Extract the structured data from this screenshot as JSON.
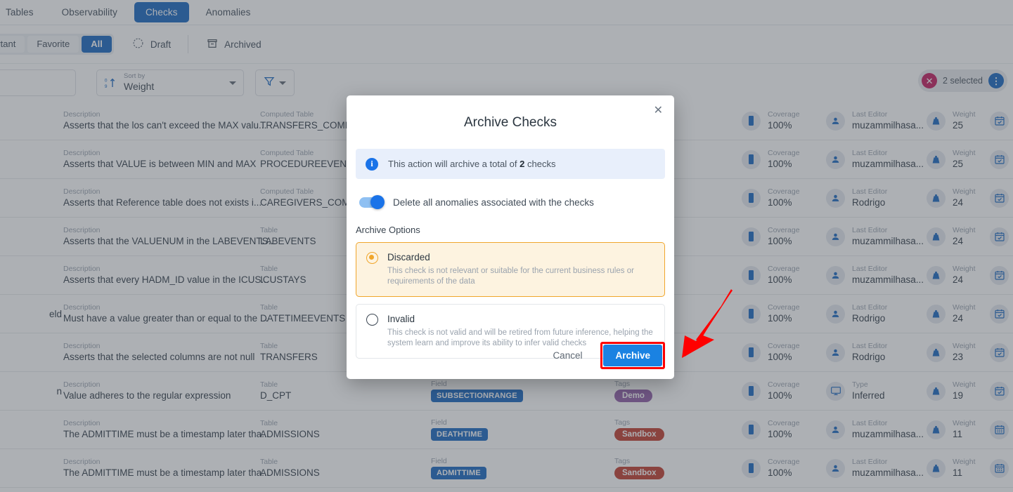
{
  "topnav": {
    "tabs": [
      {
        "label": "Tables",
        "active": false
      },
      {
        "label": "Observability",
        "active": false
      },
      {
        "label": "Checks",
        "active": true
      },
      {
        "label": "Anomalies",
        "active": false
      }
    ]
  },
  "filterbar": {
    "segments": [
      {
        "label": "mportant",
        "active": false
      },
      {
        "label": "Favorite",
        "active": false
      },
      {
        "label": "All",
        "active": true
      }
    ],
    "draft_label": "Draft",
    "archived_label": "Archived",
    "draft_icon": "draft-check-circle-icon",
    "archived_icon": "archive-box-icon"
  },
  "controls": {
    "search_placeholder": "",
    "sort_caption": "Sort by",
    "sort_value": "Weight",
    "sort_icon": "sort-ascending-icon",
    "filter_icon": "funnel-icon",
    "selection": {
      "count_label": "2 selected",
      "clear_icon": "close-circle-icon",
      "menu_icon": "more-vertical-icon",
      "clear_color": "#c2185b",
      "menu_color": "#1565c0"
    }
  },
  "table": {
    "labels": {
      "description": "Description",
      "computed_table": "Computed Table",
      "table": "Table",
      "field": "Field",
      "tags": "Tags",
      "coverage": "Coverage",
      "last_editor": "Last Editor",
      "type": "Type",
      "weight": "Weight"
    },
    "rows": [
      {
        "left_fragment": "",
        "description": "Asserts that the los can't exceed the MAX valu...",
        "table_label": "Computed Table",
        "table_value": "TRANSFERS_COMPUTE",
        "field": "",
        "tag": null,
        "coverage": "100%",
        "editor_label": "Last Editor",
        "editor": "muzammilhasa...",
        "editor_icon": "person-icon",
        "weight": "25",
        "calendar_icon": "calendar-check-icon"
      },
      {
        "left_fragment": "",
        "description": "Asserts that VALUE is between MIN and MAX",
        "table_label": "Computed Table",
        "table_value": "PROCEDUREEVENTS_M",
        "field": "",
        "tag": null,
        "coverage": "100%",
        "editor_label": "Last Editor",
        "editor": "muzammilhasa...",
        "editor_icon": "person-icon",
        "weight": "25",
        "calendar_icon": "calendar-check-icon"
      },
      {
        "left_fragment": "",
        "description": "Asserts that Reference table does not exists i...",
        "table_label": "Computed Table",
        "table_value": "CAREGIVERS_COMPUT",
        "field": "",
        "tag": null,
        "coverage": "100%",
        "editor_label": "Last Editor",
        "editor": "Rodrigo",
        "editor_icon": "person-icon",
        "weight": "24",
        "calendar_icon": "calendar-check-icon"
      },
      {
        "left_fragment": "",
        "description": "Asserts that the VALUENUM in the LABEVENTS...",
        "table_label": "Table",
        "table_value": "LABEVENTS",
        "field": "",
        "tag": null,
        "coverage": "100%",
        "editor_label": "Last Editor",
        "editor": "muzammilhasa...",
        "editor_icon": "person-icon",
        "weight": "24",
        "calendar_icon": "calendar-check-icon"
      },
      {
        "left_fragment": "",
        "description": "Asserts that every HADM_ID value in the ICUS...",
        "table_label": "Table",
        "table_value": "ICUSTAYS",
        "field": "",
        "tag": null,
        "coverage": "100%",
        "editor_label": "Last Editor",
        "editor": "muzammilhasa...",
        "editor_icon": "person-icon",
        "weight": "24",
        "calendar_icon": "calendar-check-icon"
      },
      {
        "left_fragment": "eld",
        "description": "Must have a value greater than or equal to the ...",
        "table_label": "Table",
        "table_value": "DATETIMEEVENTS",
        "field": "",
        "tag": null,
        "coverage": "100%",
        "editor_label": "Last Editor",
        "editor": "Rodrigo",
        "editor_icon": "person-icon",
        "weight": "24",
        "calendar_icon": "calendar-check-icon"
      },
      {
        "left_fragment": "",
        "description": "Asserts that the selected columns are not null",
        "table_label": "Table",
        "table_value": "TRANSFERS",
        "field": "",
        "tag": null,
        "coverage": "100%",
        "editor_label": "Last Editor",
        "editor": "Rodrigo",
        "editor_icon": "person-icon",
        "weight": "23",
        "calendar_icon": "calendar-check-icon"
      },
      {
        "left_fragment": "n",
        "description": "Value adheres to the regular expression",
        "table_label": "Table",
        "table_value": "D_CPT",
        "field": "SUBSECTIONRANGE",
        "tag": {
          "text": "Demo",
          "color": "#8e5ba6"
        },
        "coverage": "100%",
        "editor_label": "Type",
        "editor": "Inferred",
        "editor_icon": "monitor-icon",
        "weight": "19",
        "calendar_icon": "calendar-check-icon"
      },
      {
        "left_fragment": "",
        "description": "The ADMITTIME must be a timestamp later tha...",
        "table_label": "Table",
        "table_value": "ADMISSIONS",
        "field": "DEATHTIME",
        "tag": {
          "text": "Sandbox",
          "color": "#c0392b"
        },
        "coverage": "100%",
        "editor_label": "Last Editor",
        "editor": "muzammilhasa...",
        "editor_icon": "person-icon",
        "weight": "11",
        "calendar_icon": "calendar-grid-icon"
      },
      {
        "left_fragment": "",
        "description": "The ADMITTIME must be a timestamp later tha...",
        "table_label": "Table",
        "table_value": "ADMISSIONS",
        "field": "ADMITTIME",
        "tag": {
          "text": "Sandbox",
          "color": "#c0392b"
        },
        "coverage": "100%",
        "editor_label": "Last Editor",
        "editor": "muzammilhasa...",
        "editor_icon": "person-icon",
        "weight": "11",
        "calendar_icon": "calendar-grid-icon"
      }
    ]
  },
  "modal": {
    "title": "Archive Checks",
    "close_icon": "close-icon",
    "info_icon": "info-icon",
    "info_prefix": "This action will archive a total of",
    "info_count": "2",
    "info_suffix": "checks",
    "toggle_label": "Delete all anomalies associated with the checks",
    "toggle_on": true,
    "options_title": "Archive Options",
    "options": [
      {
        "title": "Discarded",
        "description": "This check is not relevant or suitable for the current business rules or requirements of the data",
        "selected": true
      },
      {
        "title": "Invalid",
        "description": "This check is not valid and will be retired from future inference, helping the system learn and improve its ability to infer valid checks",
        "selected": false
      }
    ],
    "cancel_label": "Cancel",
    "archive_label": "Archive",
    "archive_color": "#1a82e2",
    "highlight_color": "#ff0000",
    "selected_option_color": "#f0a62c"
  },
  "annotation": {
    "arrow_color": "#ff0000",
    "arrow_name": "pointer-arrow"
  }
}
